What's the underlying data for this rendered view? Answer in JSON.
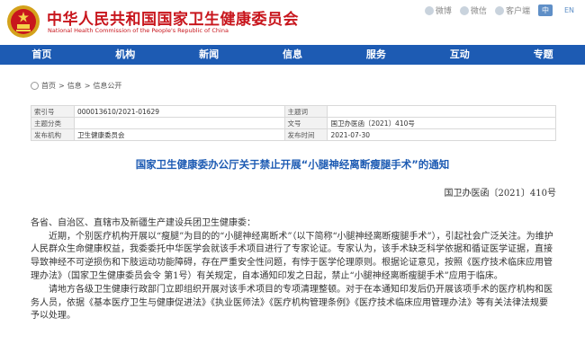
{
  "header": {
    "title_cn": "中华人民共和国国家卫生健康委员会",
    "title_en": "National Health Commission of the People's Republic of China",
    "icons": [
      {
        "name": "weibo-icon",
        "label": "微博"
      },
      {
        "name": "wechat-icon",
        "label": "微信"
      },
      {
        "name": "client-icon",
        "label": "客户端"
      }
    ],
    "lang_cn": "中",
    "lang_en": "EN"
  },
  "nav": {
    "items": [
      "首页",
      "机构",
      "新闻",
      "信息",
      "服务",
      "互动",
      "专题"
    ]
  },
  "breadcrumb": {
    "home": "首页",
    "sep": ">",
    "level1": "信息",
    "level2": "信息公开"
  },
  "meta": {
    "r1": {
      "k1": "索引号",
      "v1": "000013610/2021-01629",
      "k2": "主题词",
      "v2": ""
    },
    "r2": {
      "k1": "主题分类",
      "v1": "",
      "k2": "文号",
      "v2": "国卫办医函〔2021〕410号"
    },
    "r3": {
      "k1": "发布机构",
      "v1": "卫生健康委员会",
      "k2": "发布时间",
      "v2": "2021-07-30"
    }
  },
  "doc": {
    "title": "国家卫生健康委办公厅关于禁止开展“小腿神经离断瘦腿手术”的通知",
    "number": "国卫办医函〔2021〕410号",
    "salutation": "各省、自治区、直辖市及新疆生产建设兵团卫生健康委：",
    "para1": "近期，个别医疗机构开展以“瘦腿”为目的的“小腿神经离断术”（以下简称“小腿神经离断瘦腿手术”），引起社会广泛关注。为维护人民群众生命健康权益，我委委托中华医学会就该手术项目进行了专家论证。专家认为，该手术缺乏科学依据和循证医学证据，直接导致神经不可逆损伤和下肢运动功能障碍，存在严重安全性问题，有悖于医学伦理原则。根据论证意见，按照《医疗技术临床应用管理办法》（国家卫生健康委员会令 第1号）有关规定，自本通知印发之日起，禁止“小腿神经离断瘦腿手术”应用于临床。",
    "para2": "请地方各级卫生健康行政部门立即组织开展对该手术项目的专项清理整顿。对于在本通知印发后仍开展该项手术的医疗机构和医务人员，依据《基本医疗卫生与健康促进法》《执业医师法》《医疗机构管理条例》《医疗技术临床应用管理办法》等有关法律法规要予以处理。"
  }
}
